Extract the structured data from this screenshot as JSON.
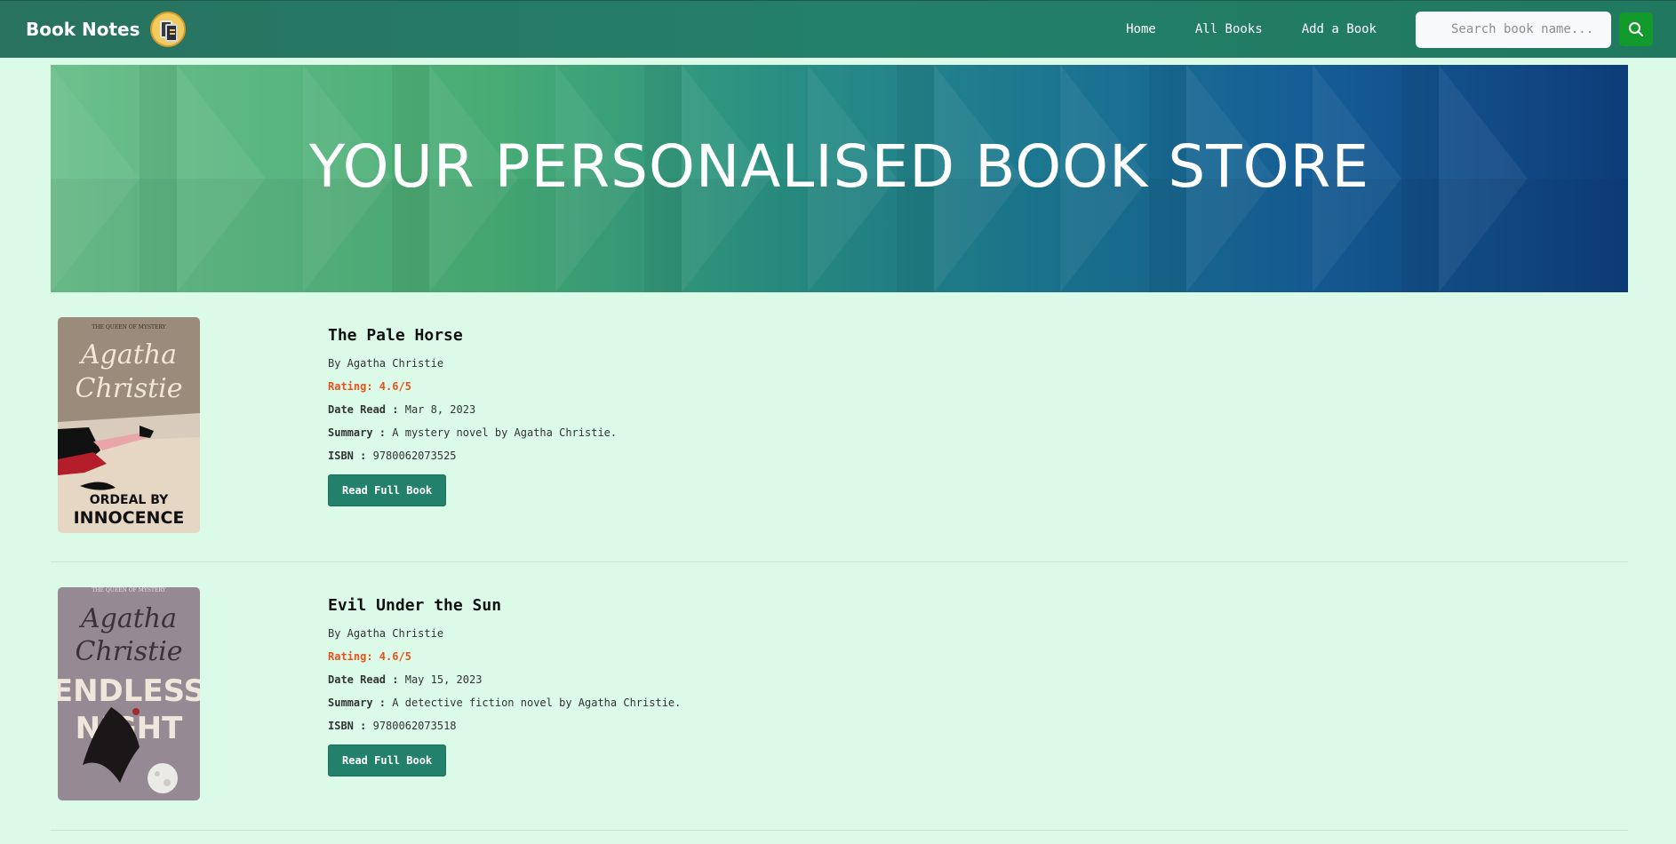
{
  "navbar": {
    "brand": "Book Notes",
    "links": [
      "Home",
      "All Books",
      "Add a Book"
    ],
    "search_placeholder": "Search book name...",
    "search_value": "",
    "search_icon": "search-icon",
    "logo_icon": "books-icon"
  },
  "hero": {
    "title": "YOUR PERSONALISED BOOK STORE"
  },
  "books": [
    {
      "title": "The Pale Horse",
      "author": "By Agatha Christie",
      "rating": "Rating: 4.6/5",
      "date_label": "Date Read :",
      "date": "Mar 8, 2023",
      "summary_label": "Summary :",
      "summary": "A mystery novel by Agatha Christie.",
      "isbn_label": "ISBN :",
      "isbn": "9780062073525",
      "button": "Read Full Book",
      "cover": {
        "top_text": "THE QUEEN OF MYSTERY",
        "author_script": "Agatha Christie",
        "title_line1": "ORDEAL BY",
        "title_line2": "INNOCENCE"
      }
    },
    {
      "title": "Evil Under the Sun",
      "author": "By Agatha Christie",
      "rating": "Rating: 4.6/5",
      "date_label": "Date Read :",
      "date": "May 15, 2023",
      "summary_label": "Summary :",
      "summary": "A detective fiction novel by Agatha Christie.",
      "isbn_label": "ISBN :",
      "isbn": "9780062073518",
      "button": "Read Full Book",
      "cover": {
        "top_text": "THE QUEEN OF MYSTERY",
        "author_script": "Agatha Christie",
        "title_line1": "ENDLESS",
        "title_line2": "NIGHT"
      }
    }
  ],
  "colors": {
    "background": "#dcfae8",
    "navbar": "#23806a",
    "rating": "#e4531d",
    "search_button": "#129a2c"
  }
}
